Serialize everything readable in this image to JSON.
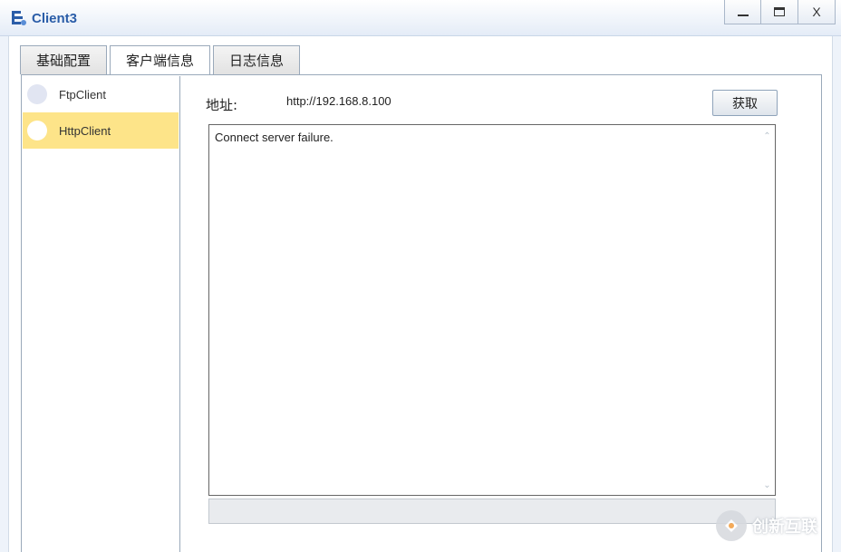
{
  "window": {
    "title": "Client3",
    "controls": {
      "minimize_icon": "minimize-icon",
      "maximize_icon": "maximize-icon",
      "close_label": "X"
    }
  },
  "tabs": [
    {
      "label": "基础配置",
      "active": false
    },
    {
      "label": "客户端信息",
      "active": true
    },
    {
      "label": "日志信息",
      "active": false
    }
  ],
  "sidebar": {
    "items": [
      {
        "label": "FtpClient",
        "selected": false
      },
      {
        "label": "HttpClient",
        "selected": true
      }
    ]
  },
  "form": {
    "address_label": "地址:",
    "address_value": "http://192.168.8.100",
    "fetch_label": "获取"
  },
  "output": {
    "text": "Connect server failure."
  },
  "watermark": {
    "text": "创新互联"
  },
  "colors": {
    "title": "#2a5da8",
    "selected_item": "#fde489",
    "background": "#eef3fa"
  }
}
